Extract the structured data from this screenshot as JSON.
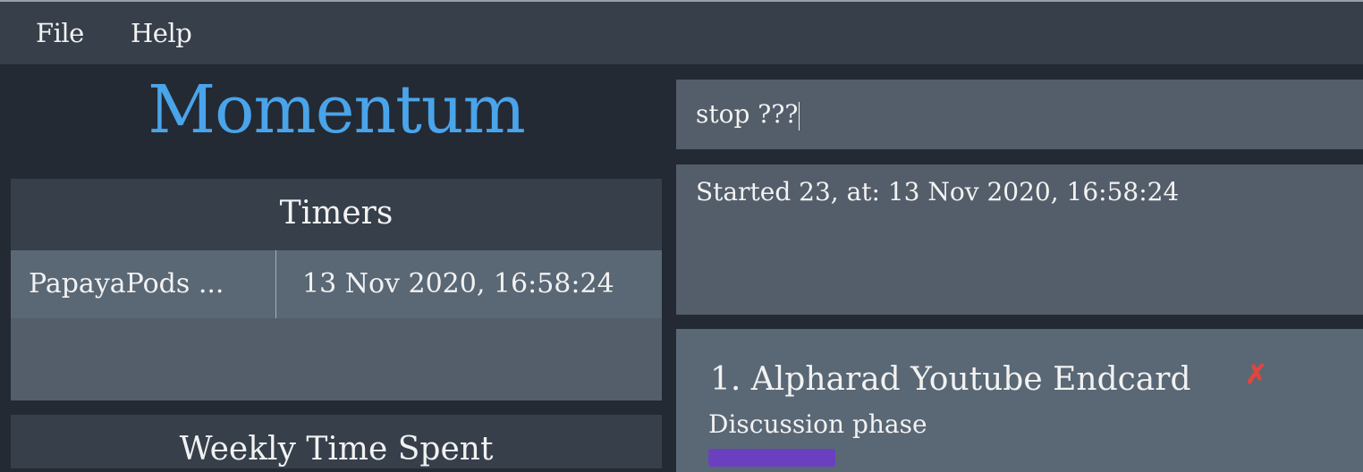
{
  "menu": {
    "items": [
      "File",
      "Help"
    ]
  },
  "app": {
    "title": "Momentum"
  },
  "command": {
    "value": "stop ???"
  },
  "result": {
    "message": "Started 23, at: 13 Nov 2020, 16:58:24"
  },
  "timers": {
    "title": "Timers",
    "rows": [
      {
        "name": "PapayaPods ...",
        "time": "13 Nov 2020, 16:58:24"
      }
    ]
  },
  "weekly": {
    "title": "Weekly Time Spent"
  },
  "projects": [
    {
      "title": "1. Alpharad Youtube Endcard",
      "description": "Discussion phase",
      "delete_icon": "cross-mark-icon",
      "tag_color": "#6a40c0"
    }
  ],
  "colors": {
    "accent": "#4aa4ea",
    "delete": "#e0463c"
  }
}
